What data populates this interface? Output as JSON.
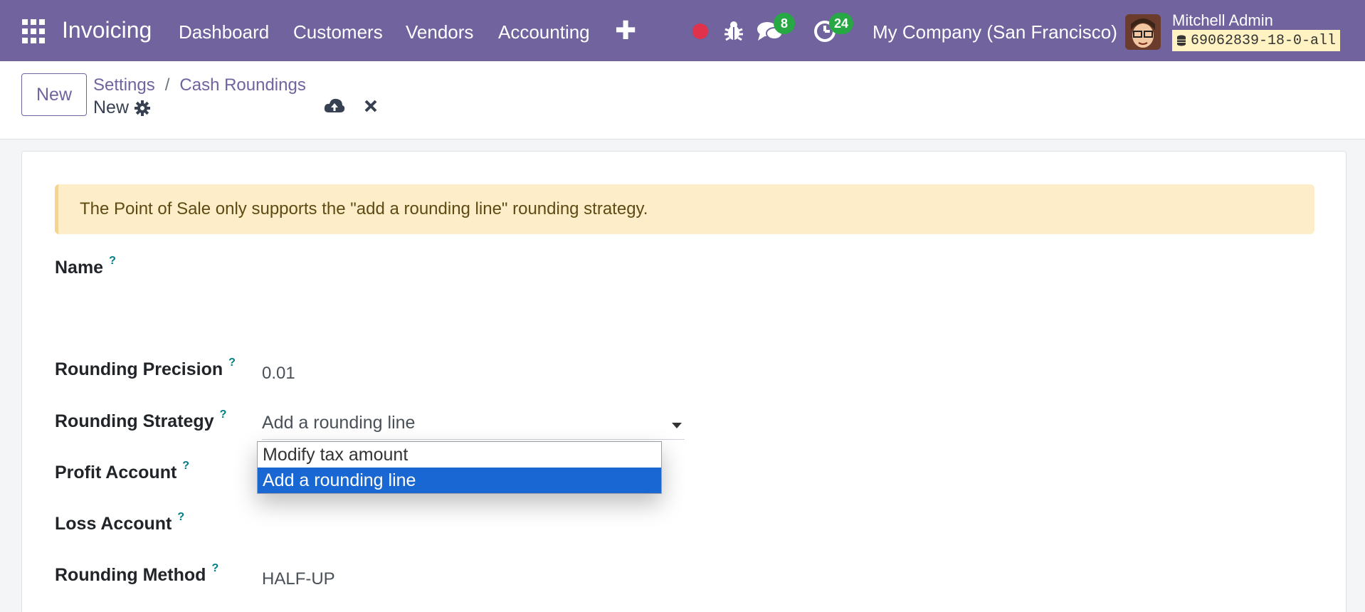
{
  "navbar": {
    "app_name": "Invoicing",
    "menu": [
      "Dashboard",
      "Customers",
      "Vendors",
      "Accounting"
    ],
    "messages_count": "8",
    "activities_count": "24",
    "company": "My Company (San Francisco)",
    "user_name": "Mitchell Admin",
    "database": "69062839-18-0-all",
    "theme_color": "#71639e"
  },
  "control_panel": {
    "new_label": "New",
    "breadcrumb": [
      "Settings",
      "Cash Roundings"
    ],
    "breadcrumb_sep": "/",
    "record_title": "New"
  },
  "form": {
    "alert": "The Point of Sale only supports the \"add a rounding line\" rounding strategy.",
    "fields": {
      "name": {
        "label": "Name",
        "value": ""
      },
      "precision": {
        "label": "Rounding Precision",
        "value": "0.01"
      },
      "strategy": {
        "label": "Rounding Strategy",
        "value": "Add a rounding line"
      },
      "profit_account": {
        "label": "Profit Account",
        "value": ""
      },
      "loss_account": {
        "label": "Loss Account",
        "value": ""
      },
      "method": {
        "label": "Rounding Method",
        "value": "HALF-UP"
      }
    },
    "help_mark": "?",
    "strategy_options": [
      "Modify tax amount",
      "Add a rounding line"
    ],
    "strategy_selected_index": 1
  }
}
